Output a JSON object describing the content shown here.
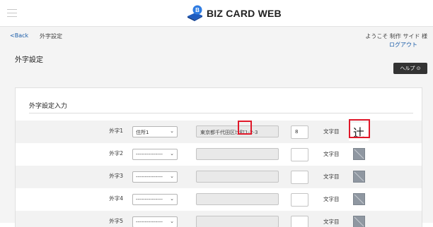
{
  "header": {
    "brand": "BIZ CARD WEB"
  },
  "nav": {
    "back_label": "Back",
    "breadcrumb": "外字設定",
    "welcome": "ようこそ 制作 サイド 様",
    "logout": "ログアウト"
  },
  "page": {
    "title": "外字設定",
    "help_label": "ヘルプ"
  },
  "section": {
    "title": "外字設定入力"
  },
  "rows": [
    {
      "label": "外字1",
      "field": "住所1",
      "text": "東京都千代田区辻町1-2-3",
      "position": "8",
      "unit": "文字目",
      "glyph": "辻"
    },
    {
      "label": "外字2",
      "field": "---------------",
      "text": "",
      "position": "",
      "unit": "文字目"
    },
    {
      "label": "外字3",
      "field": "---------------",
      "text": "",
      "position": "",
      "unit": "文字目"
    },
    {
      "label": "外字4",
      "field": "---------------",
      "text": "",
      "position": "",
      "unit": "文字目"
    },
    {
      "label": "外字5",
      "field": "---------------",
      "text": "",
      "position": "",
      "unit": "文字目"
    }
  ],
  "colors": {
    "link": "#1a5ca8",
    "highlight": "#e0182a",
    "help_bg": "#333333"
  }
}
